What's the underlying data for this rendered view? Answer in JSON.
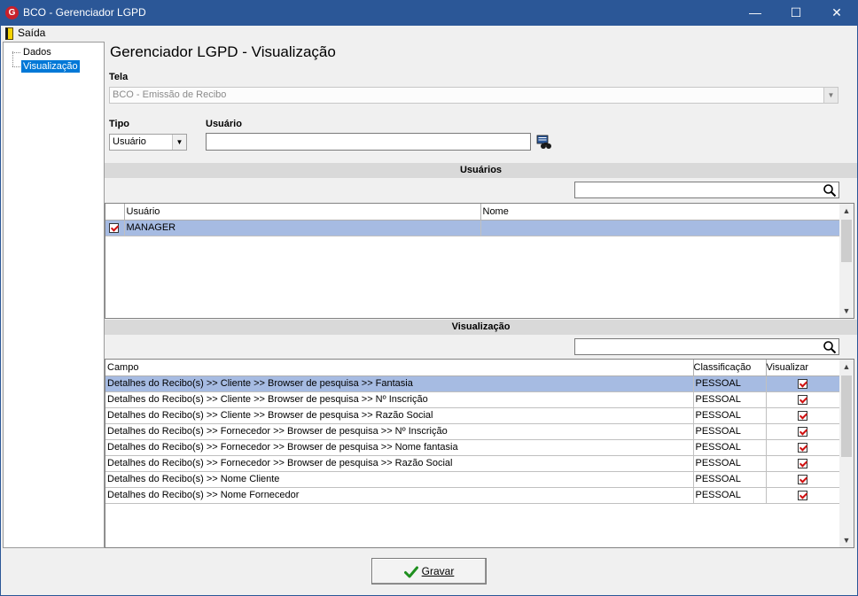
{
  "window": {
    "title": "BCO - Gerenciador LGPD",
    "app_icon_letter": "G",
    "minimize_glyph": "—",
    "maximize_glyph": "☐",
    "close_glyph": "✕"
  },
  "menu": {
    "exit_label": "Saída"
  },
  "sidebar": {
    "items": [
      {
        "label": "Dados",
        "selected": false
      },
      {
        "label": "Visualização",
        "selected": true
      }
    ]
  },
  "page": {
    "title": "Gerenciador LGPD - Visualização"
  },
  "form": {
    "tela_label": "Tela",
    "tela_value": "BCO - Emissão de Recibo",
    "tipo_label": "Tipo",
    "tipo_value": "Usuário",
    "usuario_label": "Usuário",
    "usuario_value": "",
    "search_icon": "binoculars-icon"
  },
  "users_section": {
    "header": "Usuários",
    "filter_value": "",
    "columns": [
      "Usuário",
      "Nome"
    ],
    "rows": [
      {
        "checked": true,
        "usuario": "MANAGER",
        "nome": ""
      }
    ]
  },
  "view_section": {
    "header": "Visualização",
    "filter_value": "",
    "columns": [
      "Campo",
      "Classificação",
      "Visualizar"
    ],
    "rows": [
      {
        "campo": "Detalhes do Recibo(s) >> Cliente >> Browser de pesquisa >> Fantasia",
        "classificacao": "PESSOAL",
        "visualizar": true
      },
      {
        "campo": "Detalhes do Recibo(s) >> Cliente >> Browser de pesquisa >> Nº Inscrição",
        "classificacao": "PESSOAL",
        "visualizar": true
      },
      {
        "campo": "Detalhes do Recibo(s) >> Cliente >> Browser de pesquisa >> Razão Social",
        "classificacao": "PESSOAL",
        "visualizar": true
      },
      {
        "campo": "Detalhes do Recibo(s) >> Fornecedor >> Browser de pesquisa >> Nº Inscrição",
        "classificacao": "PESSOAL",
        "visualizar": true
      },
      {
        "campo": "Detalhes do Recibo(s) >> Fornecedor >> Browser de pesquisa >> Nome fantasia",
        "classificacao": "PESSOAL",
        "visualizar": true
      },
      {
        "campo": "Detalhes do Recibo(s) >> Fornecedor >> Browser de pesquisa >> Razão Social",
        "classificacao": "PESSOAL",
        "visualizar": true
      },
      {
        "campo": "Detalhes do Recibo(s) >> Nome Cliente",
        "classificacao": "PESSOAL",
        "visualizar": true
      },
      {
        "campo": "Detalhes do Recibo(s) >> Nome Fornecedor",
        "classificacao": "PESSOAL",
        "visualizar": true
      }
    ]
  },
  "actions": {
    "save_label": "Gravar"
  },
  "colors": {
    "titlebar": "#2b5797",
    "selection": "#a6bbe2",
    "tree_selection": "#0078d7",
    "check": "#d01010"
  }
}
